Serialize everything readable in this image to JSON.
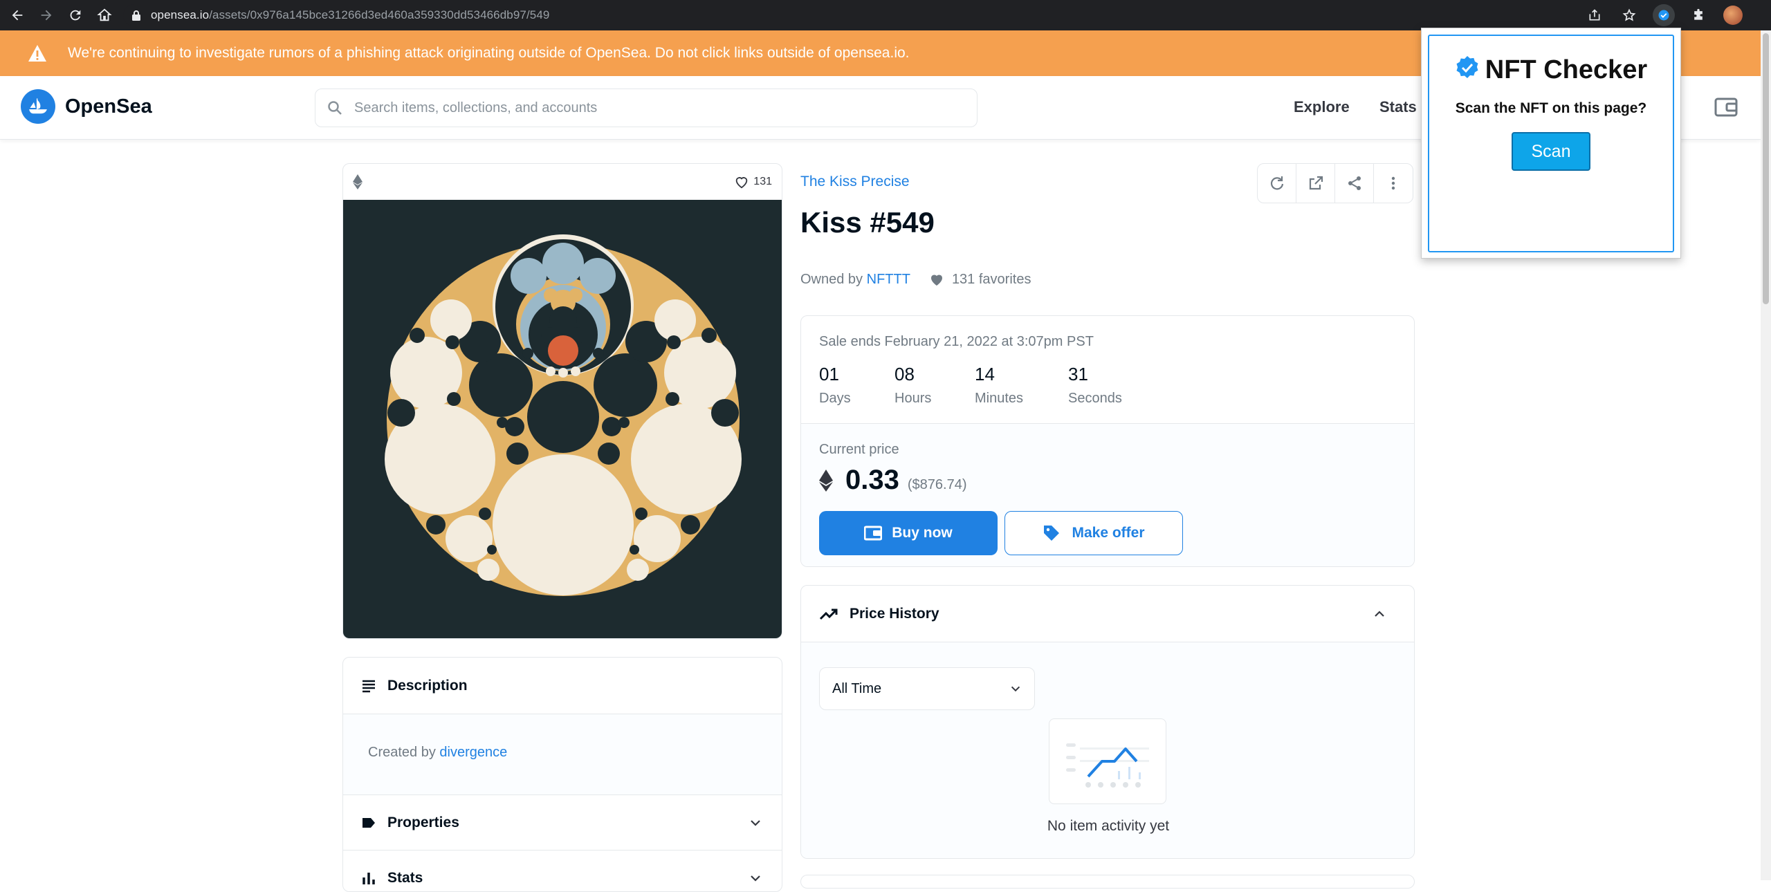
{
  "browser": {
    "url_host": "opensea.io",
    "url_path": "/assets/0x976a145bce31266d3ed460a359330dd53466db97/549"
  },
  "banner": {
    "message": "We're continuing to investigate rumors of a phishing attack originating outside of OpenSea. Do not click links outside of opensea.io."
  },
  "header": {
    "brand": "OpenSea",
    "search_placeholder": "Search items, collections, and accounts",
    "nav": [
      "Explore",
      "Stats"
    ]
  },
  "media": {
    "favorites_count": "131"
  },
  "description": {
    "heading": "Description",
    "created_by_label": "Created by",
    "creator": "divergence"
  },
  "properties": {
    "heading": "Properties"
  },
  "stats": {
    "heading": "Stats"
  },
  "item": {
    "collection": "The Kiss Precise",
    "title": "Kiss #549",
    "owned_by_label": "Owned by",
    "owner": "NFTTT",
    "favorites": "131 favorites"
  },
  "sale": {
    "ends": "Sale ends February 21, 2022 at 3:07pm PST",
    "countdown": [
      {
        "value": "01",
        "unit": "Days"
      },
      {
        "value": "08",
        "unit": "Hours"
      },
      {
        "value": "14",
        "unit": "Minutes"
      },
      {
        "value": "31",
        "unit": "Seconds"
      }
    ],
    "current_price_label": "Current price",
    "price": "0.33",
    "usd": "($876.74)",
    "buy_label": "Buy now",
    "offer_label": "Make offer"
  },
  "price_history": {
    "heading": "Price History",
    "range": "All Time",
    "empty": "No item activity yet"
  },
  "popup": {
    "title": "NFT Checker",
    "question": "Scan the NFT on this page?",
    "button": "Scan"
  },
  "colors": {
    "accent": "#2081e2",
    "banner": "#f5a04f",
    "art_bg": "#1d2b2f",
    "art_gold": "#e2b366",
    "art_cream": "#f3ecde",
    "art_red": "#d9623b",
    "art_blue": "#9ab8c8"
  }
}
